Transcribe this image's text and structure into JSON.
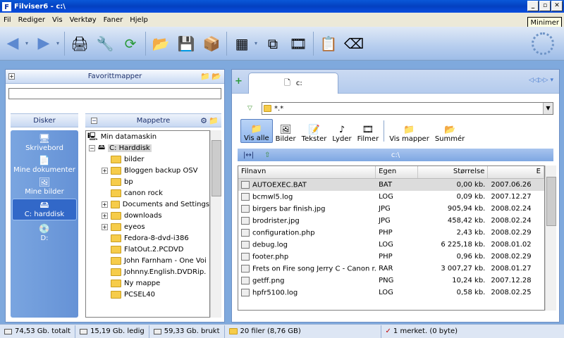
{
  "window": {
    "title": "Filviser6 - c:\\",
    "app_icon_letter": "F",
    "minimize_tooltip": "Minimer"
  },
  "menu": [
    "Fil",
    "Rediger",
    "Vis",
    "Verktøy",
    "Faner",
    "Hjelp"
  ],
  "toolbar": {
    "icons": [
      "back-arrow-icon",
      "forward-arrow-icon",
      "print-icon",
      "tools-icon",
      "refresh-icon",
      "move-to-folder-icon",
      "save-jpg-icon",
      "package-icon",
      "view-mode-icon",
      "copy-icon",
      "film-icon",
      "properties-icon",
      "eraser-icon"
    ]
  },
  "left": {
    "favorites_title": "Favorittmapper",
    "disks_title": "Disker",
    "tree_title": "Mappetre",
    "disks": [
      {
        "label": "Skrivebord",
        "icon": "desktop-icon"
      },
      {
        "label": "Mine dokumenter",
        "icon": "documents-icon"
      },
      {
        "label": "Mine bilder",
        "icon": "pictures-icon"
      },
      {
        "label": "C: harddisk",
        "icon": "harddisk-icon",
        "selected": true
      },
      {
        "label": "D:",
        "icon": "cd-icon"
      }
    ],
    "tree": [
      {
        "label": "Min datamaskin",
        "level": 0,
        "expander": ""
      },
      {
        "label": "C: Harddisk",
        "level": 1,
        "expander": "−",
        "selected": true
      },
      {
        "label": "bilder",
        "level": 2,
        "expander": ""
      },
      {
        "label": "Bloggen backup OSV",
        "level": 2,
        "expander": "+"
      },
      {
        "label": "bp",
        "level": 2,
        "expander": ""
      },
      {
        "label": "canon rock",
        "level": 2,
        "expander": ""
      },
      {
        "label": "Documents and Settings",
        "level": 2,
        "expander": "+"
      },
      {
        "label": "downloads",
        "level": 2,
        "expander": "+"
      },
      {
        "label": "eyeos",
        "level": 2,
        "expander": "+"
      },
      {
        "label": "Fedora-8-dvd-i386",
        "level": 2,
        "expander": ""
      },
      {
        "label": "FlatOut.2.PCDVD",
        "level": 2,
        "expander": ""
      },
      {
        "label": "John Farnham - One Voi",
        "level": 2,
        "expander": ""
      },
      {
        "label": "Johnny.English.DVDRip.",
        "level": 2,
        "expander": ""
      },
      {
        "label": "Ny mappe",
        "level": 2,
        "expander": ""
      },
      {
        "label": "PCSEL40",
        "level": 2,
        "expander": ""
      }
    ]
  },
  "right": {
    "tab_label": "c:",
    "filter": "*.*",
    "view_buttons": [
      "Vis alle",
      "Bilder",
      "Tekster",
      "Lyder",
      "Filmer",
      "Vis mapper",
      "Summér"
    ],
    "path": "c:\\",
    "columns": [
      "Filnavn",
      "Egen",
      "Størrelse",
      "E"
    ],
    "files": [
      {
        "name": "AUTOEXEC.BAT",
        "type": "BAT",
        "size": "0,00 kb.",
        "date": "2007.06.26"
      },
      {
        "name": "bcmwl5.log",
        "type": "LOG",
        "size": "0,09 kb.",
        "date": "2007.12.27"
      },
      {
        "name": "birgers bar finish.jpg",
        "type": "JPG",
        "size": "905,94 kb.",
        "date": "2008.02.24"
      },
      {
        "name": "brodrister.jpg",
        "type": "JPG",
        "size": "458,42 kb.",
        "date": "2008.02.24"
      },
      {
        "name": "configuration.php",
        "type": "PHP",
        "size": "2,43 kb.",
        "date": "2008.02.29"
      },
      {
        "name": "debug.log",
        "type": "LOG",
        "size": "6 225,18 kb.",
        "date": "2008.01.02"
      },
      {
        "name": "footer.php",
        "type": "PHP",
        "size": "0,96 kb.",
        "date": "2008.02.29"
      },
      {
        "name": "Frets on Fire song Jerry C - Canon r...",
        "type": "RAR",
        "size": "3 007,27 kb.",
        "date": "2008.01.27"
      },
      {
        "name": "getff.png",
        "type": "PNG",
        "size": "10,24 kb.",
        "date": "2007.12.28"
      },
      {
        "name": "hpfr5100.log",
        "type": "LOG",
        "size": "0,58 kb.",
        "date": "2008.02.25"
      }
    ]
  },
  "status": {
    "total": "74,53 Gb. totalt",
    "free": "15,19 Gb. ledig",
    "used": "59,33 Gb. brukt",
    "files": "20 filer (8,76 GB)",
    "selected": "1 merket. (0 byte)"
  }
}
